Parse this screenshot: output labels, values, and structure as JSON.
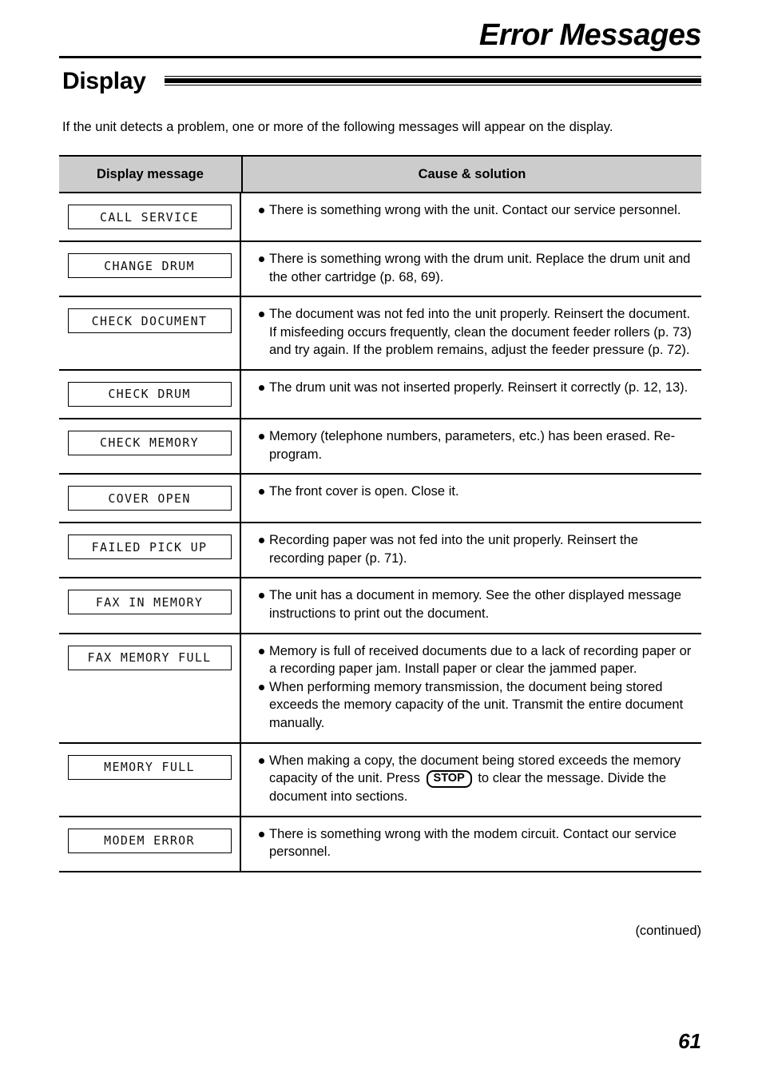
{
  "header": {
    "chapter_title": "Error Messages",
    "section_title": "Display"
  },
  "intro": "If the unit detects a problem, one or more of the following messages will appear on the display.",
  "table": {
    "columns": [
      "Display message",
      "Cause & solution"
    ],
    "rows": [
      {
        "display_message": "CALL SERVICE",
        "causes": [
          "There is something wrong with the unit. Contact our service personnel."
        ]
      },
      {
        "display_message": "CHANGE DRUM",
        "causes": [
          "There is something wrong with the drum unit. Replace the drum unit and the other cartridge (p. 68, 69)."
        ]
      },
      {
        "display_message": "CHECK DOCUMENT",
        "causes": [
          "The document was not fed into the unit properly. Reinsert the document. If misfeeding occurs frequently, clean the document feeder rollers (p. 73) and try again. If the problem remains, adjust the feeder pressure (p. 72)."
        ]
      },
      {
        "display_message": "CHECK DRUM",
        "causes": [
          "The drum unit was not inserted properly. Reinsert it correctly (p. 12, 13)."
        ]
      },
      {
        "display_message": "CHECK MEMORY",
        "causes": [
          "Memory (telephone numbers, parameters, etc.) has been erased. Re-program."
        ]
      },
      {
        "display_message": "COVER OPEN",
        "causes": [
          "The front cover is open. Close it."
        ]
      },
      {
        "display_message": "FAILED PICK UP",
        "causes": [
          "Recording paper was not fed into the unit properly. Reinsert the recording paper (p. 71)."
        ]
      },
      {
        "display_message": "FAX IN MEMORY",
        "causes": [
          "The unit has a document in memory. See the other displayed message instructions to print out the document."
        ]
      },
      {
        "display_message": "FAX MEMORY FULL",
        "causes": [
          "Memory is full of received documents due to a lack of recording paper or a recording paper jam. Install paper or clear the jammed paper.",
          "When performing memory transmission, the document being stored exceeds the memory capacity of the unit. Transmit the entire document manually."
        ]
      },
      {
        "display_message": "MEMORY FULL",
        "cause_part_1": "When making a copy, the document being stored exceeds the memory capacity of the unit. Press",
        "key_label": "STOP",
        "cause_part_2": "to clear the message. Divide the document into sections."
      },
      {
        "display_message": "MODEM ERROR",
        "causes": [
          "There is something wrong with the modem circuit. Contact our service personnel."
        ]
      }
    ]
  },
  "footer": {
    "continued": "(continued)",
    "page_number": "61"
  },
  "colors": {
    "header_fill": "#cccccc",
    "rule": "#000000",
    "text": "#000000"
  }
}
